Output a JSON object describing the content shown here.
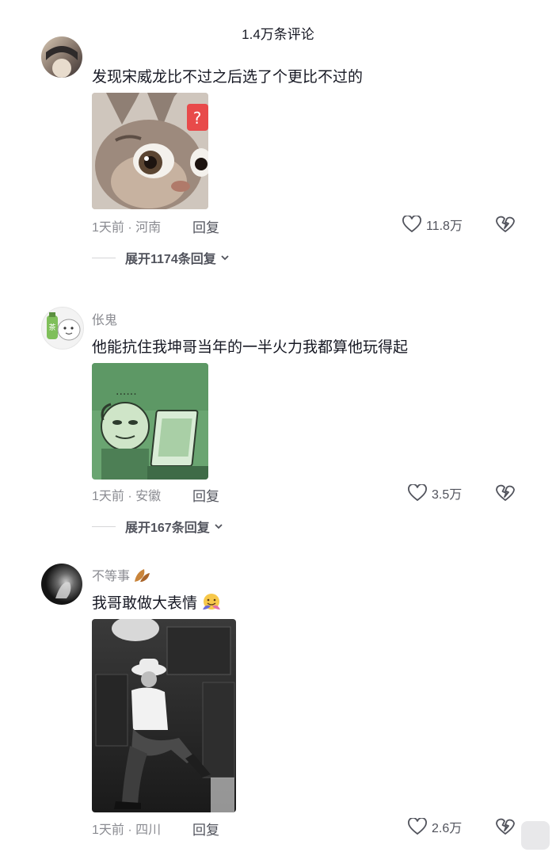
{
  "header": {
    "title": "1.4万条评论"
  },
  "comments": [
    {
      "username": "",
      "text": "发现宋威龙比不过之后选了个更比不过的",
      "time_location": "1天前 · 河南",
      "reply_label": "回复",
      "likes": "11.8万",
      "expand": "展开1174条回复"
    },
    {
      "username": "伥鬼",
      "text": "他能抗住我坤哥当年的一半火力我都算他玩得起",
      "time_location": "1天前 · 安徽",
      "reply_label": "回复",
      "likes": "3.5万",
      "expand": "展开167条回复"
    },
    {
      "username": "不等事",
      "text": "我哥敢做大表情",
      "time_location": "1天前 · 四川",
      "reply_label": "回复",
      "likes": "2.6万"
    }
  ],
  "meme2": {
    "dots": "......"
  },
  "colors": {
    "text": "#161823",
    "secondary": "#8a8b91",
    "reply": "#51535c"
  }
}
